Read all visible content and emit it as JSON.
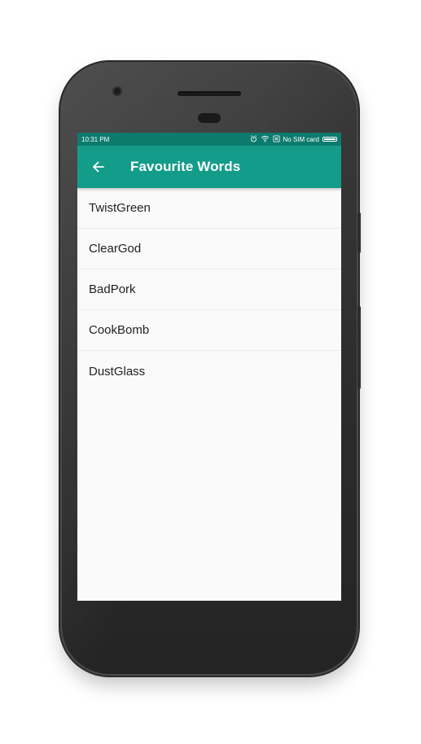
{
  "status_bar": {
    "time": "10:31 PM",
    "sim_text": "No SIM card",
    "icons": [
      "alarm-icon",
      "wifi-icon",
      "no-sim-icon",
      "battery-icon"
    ]
  },
  "app_bar": {
    "title": "Favourite Words",
    "back_icon": "arrow-left-icon"
  },
  "list": {
    "items": [
      {
        "label": "TwistGreen"
      },
      {
        "label": "ClearGod"
      },
      {
        "label": "BadPork"
      },
      {
        "label": "CookBomb"
      },
      {
        "label": "DustGlass"
      }
    ]
  },
  "colors": {
    "status_bar": "#0d7a6e",
    "app_bar": "#139c8a",
    "background": "#fafafa",
    "text": "#222222"
  }
}
